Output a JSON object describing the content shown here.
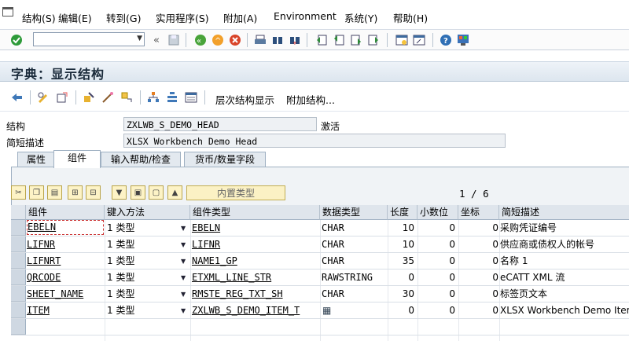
{
  "menu": [
    "结构(S)",
    "编辑(E)",
    "转到(G)",
    "实用程序(S)",
    "附加(A)",
    "Environment",
    "系统(Y)",
    "帮助(H)"
  ],
  "title": "字典：显示结构",
  "app_toolbar": {
    "hierarchy": "层次结构显示",
    "append": "附加结构..."
  },
  "form": {
    "struct_label": "结构",
    "struct_value": "ZXLWB_S_DEMO_HEAD",
    "status": "激活",
    "desc_label": "简短描述",
    "desc_value": "XLSX Workbench Demo Head"
  },
  "tabs": [
    "属性",
    "组件",
    "输入帮助/检查",
    "货币/数量字段"
  ],
  "active_tab": "组件",
  "builtin_button": "内置类型",
  "page_counter": "1 / 6",
  "columns": [
    "组件",
    "键入方法",
    "组件类型",
    "数据类型",
    "长度",
    "小数位",
    "坐标",
    "简短描述"
  ],
  "rows": [
    {
      "comp": "EBELN",
      "typing": "1 类型",
      "ctype": "EBELN",
      "dtype": "CHAR",
      "len": "10",
      "dec": "0",
      "coord": "0",
      "desc": "采购凭证编号"
    },
    {
      "comp": "LIFNR",
      "typing": "1 类型",
      "ctype": "LIFNR",
      "dtype": "CHAR",
      "len": "10",
      "dec": "0",
      "coord": "0",
      "desc": "供应商或债权人的帐号"
    },
    {
      "comp": "LIFNRT",
      "typing": "1 类型",
      "ctype": "NAME1_GP",
      "dtype": "CHAR",
      "len": "35",
      "dec": "0",
      "coord": "0",
      "desc": "名称 1"
    },
    {
      "comp": "QRCODE",
      "typing": "1 类型",
      "ctype": "ETXML_LINE_STR",
      "dtype": "RAWSTRING",
      "len": "0",
      "dec": "0",
      "coord": "0",
      "desc": "eCATT XML 流"
    },
    {
      "comp": "SHEET_NAME",
      "typing": "1 类型",
      "ctype": "RMSTE_REG_TXT_SH",
      "dtype": "CHAR",
      "len": "30",
      "dec": "0",
      "coord": "0",
      "desc": "标签页文本"
    },
    {
      "comp": "ITEM",
      "typing": "1 类型",
      "ctype": "ZXLWB_S_DEMO_ITEM_T",
      "dtype": "table-icon",
      "len": "0",
      "dec": "0",
      "coord": "0",
      "desc": "XLSX Workbench Demo Item"
    }
  ],
  "colors": {
    "accent": "#1c6fb3",
    "title_bg": "#dde6ef",
    "header_bg": "#dfe5ec",
    "button_yellow": "#fdf3c6"
  }
}
